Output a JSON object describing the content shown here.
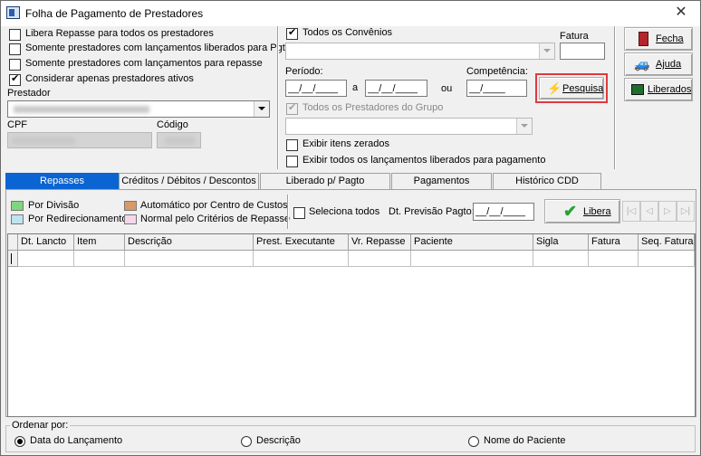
{
  "window": {
    "title": "Folha de Pagamento de Prestadores",
    "close": "✕"
  },
  "options": {
    "libera_todos": {
      "label": "Libera Repasse para todos os prestadores",
      "checked": false
    },
    "somente_liberados": {
      "label": "Somente prestadores com lançamentos liberados para Pgto.",
      "checked": false
    },
    "somente_repasse": {
      "label": "Somente prestadores com lançamentos para repasse",
      "checked": false
    },
    "apenas_ativos": {
      "label": "Considerar apenas prestadores ativos",
      "checked": true
    }
  },
  "prestador": {
    "label": "Prestador"
  },
  "cpf": {
    "label": "CPF"
  },
  "codigo": {
    "label": "Código"
  },
  "convenios": {
    "label": "Todos os Convênios",
    "checked": true
  },
  "fatura": {
    "label": "Fatura",
    "value": ""
  },
  "periodo": {
    "label": "Período:",
    "from": "__/__/____",
    "sep": "a",
    "to": "__/__/____",
    "ou": "ou"
  },
  "competencia": {
    "label": "Competência:",
    "value": "__/____"
  },
  "grupo": {
    "label": "Todos os Prestadores do Grupo",
    "checked": true
  },
  "exibir_zerados": {
    "label": "Exibir itens zerados",
    "checked": false
  },
  "exibir_liberados": {
    "label": "Exibir todos os lançamentos liberados para pagamento",
    "checked": false
  },
  "buttons": {
    "pesquisa": "Pesquisa",
    "fecha": "Fecha",
    "ajuda": "Ajuda",
    "liberados": "Liberados",
    "libera": "Libera"
  },
  "tabs": [
    "Repasses",
    "Créditos / Débitos / Descontos",
    "Liberado p/ Pagto",
    "Pagamentos",
    "Histórico CDD"
  ],
  "legend": {
    "por_divisao": {
      "label": "Por Divisão",
      "color": "#7fd67f"
    },
    "por_redirecionamento": {
      "label": "Por Redirecionamento",
      "color": "#bfe3ef"
    },
    "automatico": {
      "label": "Automático por Centro de Custos",
      "color": "#d99a63"
    },
    "normal": {
      "label": "Normal pelo Critérios de Repasse",
      "color": "#f6d7ea"
    }
  },
  "seleciona_todos": {
    "label": "Seleciona todos",
    "checked": false
  },
  "previsao": {
    "label": "Dt. Previsão Pagto:",
    "value": "__/__/____"
  },
  "nav": [
    "|◁",
    "◁",
    "▷",
    "▷|"
  ],
  "grid": {
    "columns": [
      "Dt. Lancto",
      "Item",
      "Descrição",
      "Prest. Executante",
      "Vr. Repasse",
      "Paciente",
      "Sigla",
      "Fatura",
      "Seq. Fatura"
    ]
  },
  "ordenar": {
    "label": "Ordenar por:",
    "options": [
      {
        "label": "Data do Lançamento",
        "selected": true
      },
      {
        "label": "Descrição",
        "selected": false
      },
      {
        "label": "Nome do Paciente",
        "selected": false
      }
    ]
  },
  "colors": {
    "accent": "#0a64d2",
    "highlight": "#e0393e",
    "pesquisa_icon": "#f2c200"
  }
}
